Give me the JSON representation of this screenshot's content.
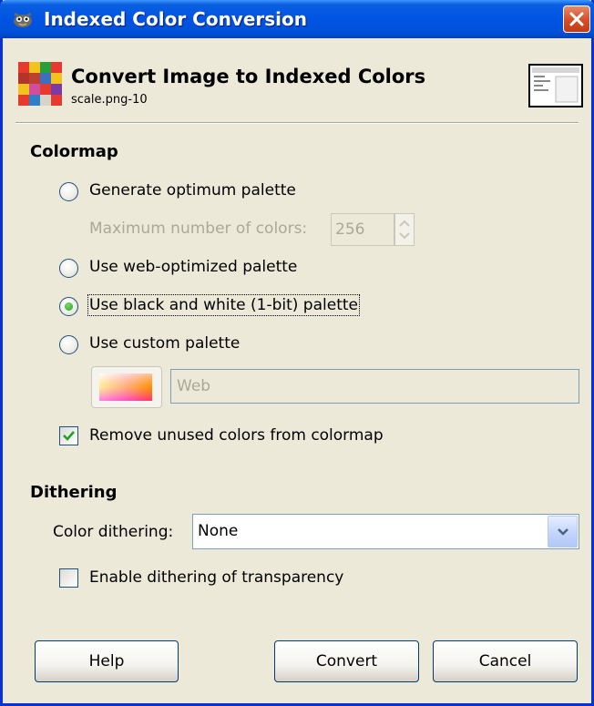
{
  "window": {
    "title": "Indexed Color Conversion",
    "header_title": "Convert Image to Indexed Colors",
    "header_subtitle": "scale.png-10",
    "titlebar_color": "#0054e3",
    "close_color": "#d6502a"
  },
  "colormap": {
    "section_label": "Colormap",
    "options": [
      {
        "label": "Generate optimum palette",
        "selected": false
      },
      {
        "label": "Use web-optimized palette",
        "selected": false
      },
      {
        "label": "Use black and white (1-bit) palette",
        "selected": true
      },
      {
        "label": "Use custom palette",
        "selected": false
      }
    ],
    "max_colors_label": "Maximum number of colors:",
    "max_colors_value": "256",
    "custom_palette_name": "Web",
    "remove_unused_label": "Remove unused colors from colormap",
    "remove_unused_checked": true
  },
  "dithering": {
    "section_label": "Dithering",
    "color_dithering_label": "Color dithering:",
    "color_dithering_value": "None",
    "transparency_label": "Enable dithering of transparency",
    "transparency_checked": false
  },
  "buttons": {
    "help": "Help",
    "convert": "Convert",
    "cancel": "Cancel"
  },
  "icons": {
    "app": "gimp-icon",
    "header": "indexed-color-icon",
    "close": "close-icon",
    "dropdown": "chevron-down-icon"
  }
}
